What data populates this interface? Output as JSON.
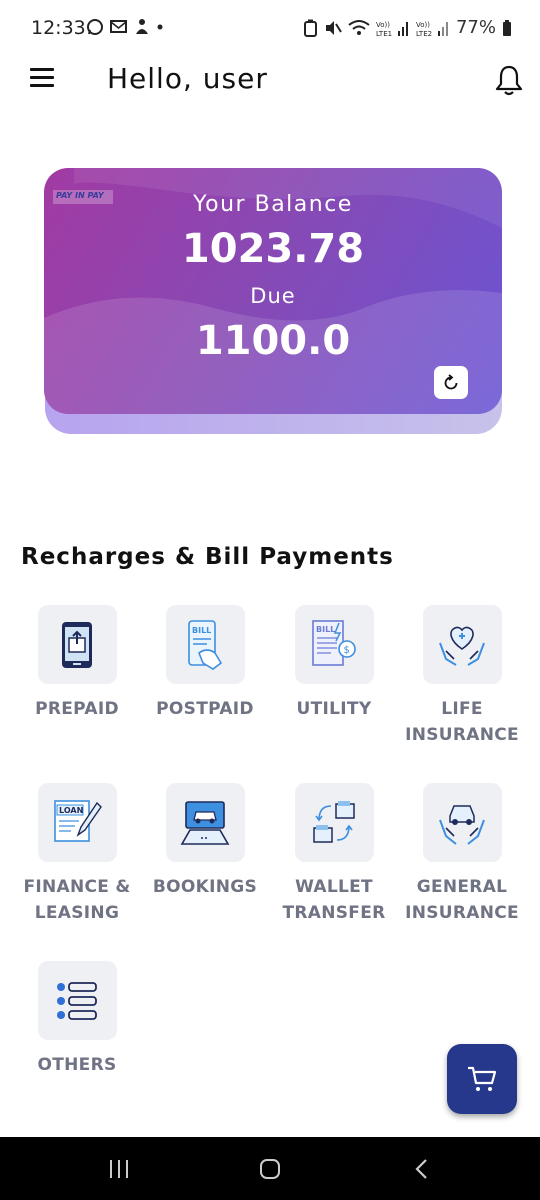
{
  "status_bar": {
    "time": "12:33",
    "battery": "77%"
  },
  "app_bar": {
    "greeting": "Hello, user"
  },
  "balance_card": {
    "logo_text": "PAY IN PAY",
    "balance_label": "Your Balance",
    "balance_value": "1023.78",
    "due_label": "Due",
    "due_value": "1100.0"
  },
  "services": {
    "title": "Recharges & Bill Payments",
    "items": [
      {
        "label": "PREPAID",
        "icon": "prepaid-phone-icon"
      },
      {
        "label": "POSTPAID",
        "icon": "postpaid-bill-icon"
      },
      {
        "label": "UTILITY",
        "icon": "utility-bill-icon"
      },
      {
        "label": "LIFE\nINSURANCE",
        "icon": "life-insurance-icon"
      },
      {
        "label": "FINANCE &\nLEASING",
        "icon": "loan-icon"
      },
      {
        "label": "BOOKINGS",
        "icon": "bookings-icon"
      },
      {
        "label": "WALLET\nTRANSFER",
        "icon": "wallet-transfer-icon"
      },
      {
        "label": "GENERAL\nINSURANCE",
        "icon": "general-insurance-icon"
      },
      {
        "label": "OTHERS",
        "icon": "others-list-icon"
      }
    ]
  },
  "colors": {
    "card_start": "#a23aa3",
    "card_end": "#6a55d4",
    "fab": "#26388b",
    "tile_bg": "#eef0f4",
    "label": "#6f7384"
  }
}
